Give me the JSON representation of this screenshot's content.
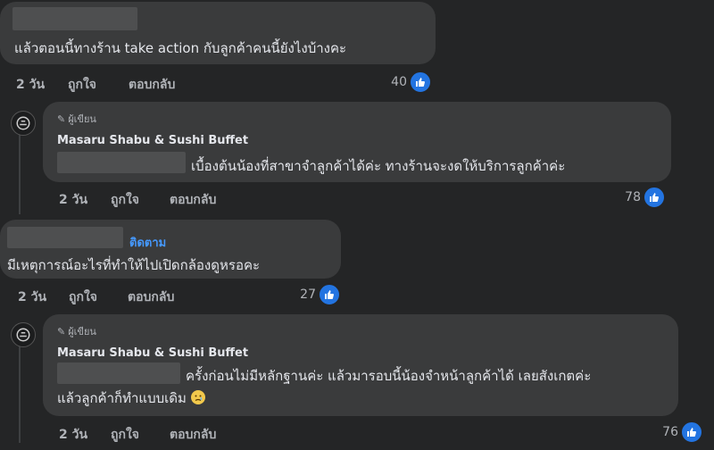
{
  "comment1": {
    "text": "แล้วตอนนี้ทางร้าน take action กับลูกค้าคนนี้ยังไงบ้างคะ",
    "time": "2 วัน",
    "like_action": "ถูกใจ",
    "reply_action": "ตอบกลับ",
    "likes": "40"
  },
  "reply1": {
    "badge": "ผู้เขียน",
    "author": "Masaru Shabu & Sushi Buffet",
    "text": "เบื้องต้นน้องที่สาขาจำลูกค้าได้ค่ะ ทางร้านจะงดให้บริการลูกค้าค่ะ",
    "time": "2 วัน",
    "like_action": "ถูกใจ",
    "reply_action": "ตอบกลับ",
    "likes": "78"
  },
  "comment2": {
    "follow": "ติดตาม",
    "text": "มีเหตุการณ์อะไรที่ทำให้ไปเปิดกล้องดูหรอคะ",
    "time": "2 วัน",
    "like_action": "ถูกใจ",
    "reply_action": "ตอบกลับ",
    "likes": "27"
  },
  "reply2": {
    "badge": "ผู้เขียน",
    "author": "Masaru Shabu & Sushi Buffet",
    "text_line1": "ครั้งก่อนไม่มีหลักฐานค่ะ แล้วมารอบนี้น้องจำหน้าลูกค้าได้ เลยสังเกตค่ะ",
    "text_line2": "แล้วลูกค้าก็ทำแบบเดิม",
    "time": "2 วัน",
    "like_action": "ถูกใจ",
    "reply_action": "ตอบกลับ",
    "likes": "76"
  },
  "icons": {
    "like": "thumbs-up-icon",
    "author": "pencil-icon",
    "emoji": "sad-face-emoji"
  },
  "colors": {
    "background": "#242526",
    "bubble": "#3a3b3c",
    "like_blue": "#2374e1",
    "follow_blue": "#4599ff",
    "muted": "#b0b3b8"
  }
}
